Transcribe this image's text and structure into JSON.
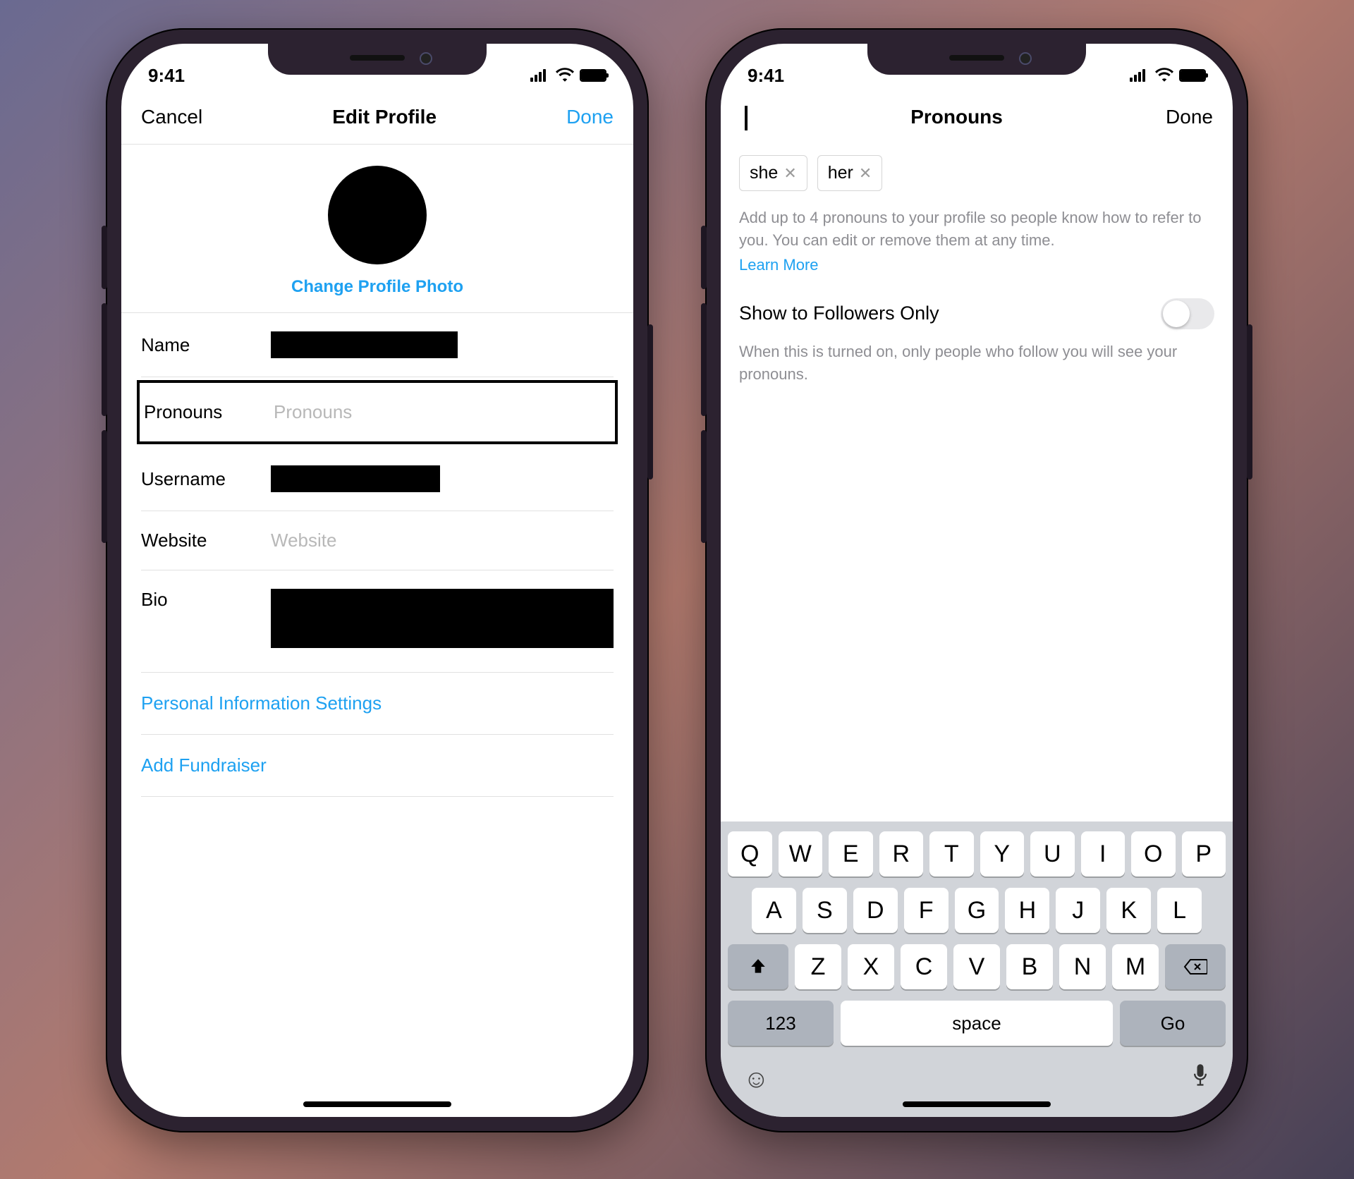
{
  "status": {
    "time": "9:41"
  },
  "left": {
    "nav": {
      "cancel": "Cancel",
      "title": "Edit Profile",
      "done": "Done"
    },
    "change_photo": "Change Profile Photo",
    "fields": {
      "name_label": "Name",
      "pronouns_label": "Pronouns",
      "pronouns_placeholder": "Pronouns",
      "username_label": "Username",
      "website_label": "Website",
      "website_placeholder": "Website",
      "bio_label": "Bio"
    },
    "links": {
      "personal_info": "Personal Information Settings",
      "add_fundraiser": "Add Fundraiser"
    }
  },
  "right": {
    "nav": {
      "title": "Pronouns",
      "done": "Done"
    },
    "chips": [
      "she",
      "her"
    ],
    "help": "Add up to 4 pronouns to your profile so people know how to refer to you. You can edit or remove them at any time.",
    "learn_more": "Learn More",
    "toggle_label": "Show to Followers Only",
    "toggle_sub": "When this is turned on, only people who follow you will see your pronouns.",
    "keyboard": {
      "row1": [
        "Q",
        "W",
        "E",
        "R",
        "T",
        "Y",
        "U",
        "I",
        "O",
        "P"
      ],
      "row2": [
        "A",
        "S",
        "D",
        "F",
        "G",
        "H",
        "J",
        "K",
        "L"
      ],
      "row3": [
        "Z",
        "X",
        "C",
        "V",
        "B",
        "N",
        "M"
      ],
      "numbers": "123",
      "space": "space",
      "go": "Go"
    }
  }
}
